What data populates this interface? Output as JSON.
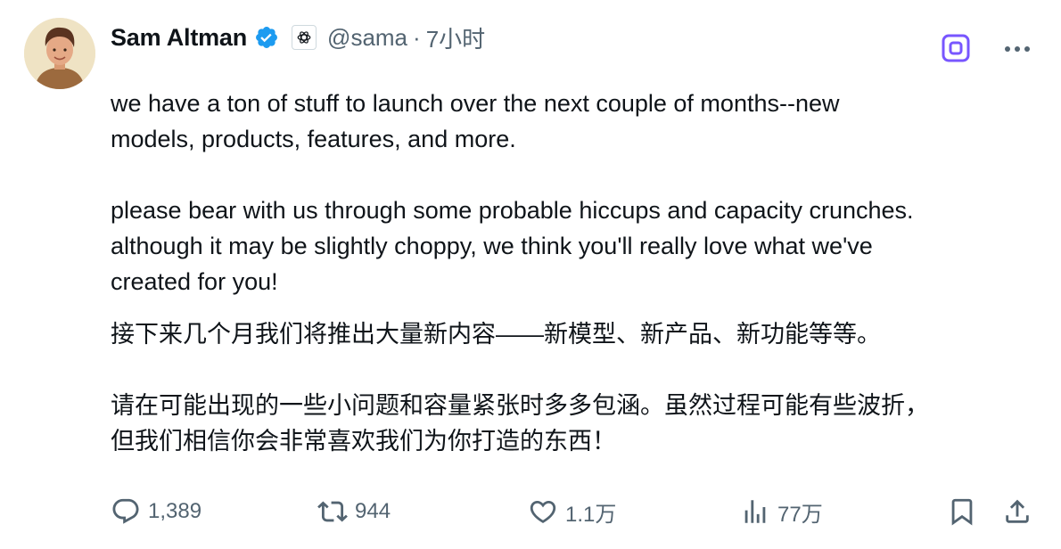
{
  "tweet": {
    "author": {
      "name": "Sam Altman",
      "handle": "@sama",
      "separator": "·",
      "time": "7小时",
      "verified_icon": "verified-badge-icon",
      "affiliate_icon": "openai-logo-icon"
    },
    "text": {
      "en_p1": "we have a ton of stuff to launch over the next couple of months--new\nmodels, products, features, and more.",
      "en_p2": "please bear with us through some probable hiccups and capacity crunches.\nalthough it may be slightly choppy, we think you'll really love what we've\ncreated for you!",
      "zh_p1": "接下来几个月我们将推出大量新内容——新模型、新产品、新功能等等。",
      "zh_p2": "请在可能出现的一些小问题和容量紧张时多多包涵。虽然过程可能有些波折，\n但我们相信你会非常喜欢我们为你打造的东西！"
    },
    "actions": {
      "replies": "1,389",
      "retweets": "944",
      "likes": "1.1万",
      "views": "77万"
    }
  },
  "icons": {
    "reply": "reply-icon",
    "retweet": "retweet-icon",
    "like": "heart-icon",
    "views": "analytics-icon",
    "bookmark": "bookmark-icon",
    "share": "share-icon",
    "grok": "grok-icon",
    "more": "more-icon"
  },
  "colors": {
    "text_primary": "#0f1419",
    "text_secondary": "#536471",
    "verified_blue": "#1d9bf0",
    "grok_purple": "#7856ff"
  }
}
